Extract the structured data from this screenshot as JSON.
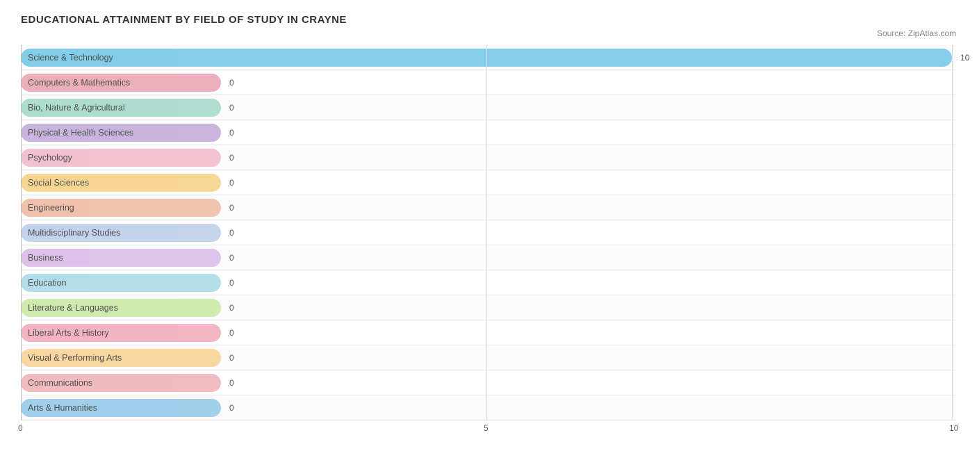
{
  "title": "EDUCATIONAL ATTAINMENT BY FIELD OF STUDY IN CRAYNE",
  "source": "Source: ZipAtlas.com",
  "chart": {
    "x_axis_labels": [
      "0",
      "5",
      "10"
    ],
    "max_value": 10,
    "bars": [
      {
        "label": "Science & Technology",
        "value": 10,
        "color": "#6ec6e8",
        "pct": 100
      },
      {
        "label": "Computers & Mathematics",
        "value": 0,
        "color": "#e8a0b0",
        "pct": 2.8
      },
      {
        "label": "Bio, Nature & Agricultural",
        "value": 0,
        "color": "#a0d8c8",
        "pct": 2.8
      },
      {
        "label": "Physical & Health Sciences",
        "value": 0,
        "color": "#b8a0d8",
        "pct": 2.8
      },
      {
        "label": "Psychology",
        "value": 0,
        "color": "#f0b8c0",
        "pct": 2.8
      },
      {
        "label": "Social Sciences",
        "value": 0,
        "color": "#f5d080",
        "pct": 2.8
      },
      {
        "label": "Engineering",
        "value": 0,
        "color": "#f0b8a8",
        "pct": 2.8
      },
      {
        "label": "Multidisciplinary Studies",
        "value": 0,
        "color": "#c8d8f0",
        "pct": 2.8
      },
      {
        "label": "Business",
        "value": 0,
        "color": "#d8c0e0",
        "pct": 2.8
      },
      {
        "label": "Education",
        "value": 0,
        "color": "#a8d8e8",
        "pct": 2.8
      },
      {
        "label": "Literature & Languages",
        "value": 0,
        "color": "#d0e8a0",
        "pct": 2.8
      },
      {
        "label": "Liberal Arts & History",
        "value": 0,
        "color": "#f0b0c0",
        "pct": 2.8
      },
      {
        "label": "Visual & Performing Arts",
        "value": 0,
        "color": "#f8d090",
        "pct": 2.8
      },
      {
        "label": "Communications",
        "value": 0,
        "color": "#f0b8c0",
        "pct": 2.8
      },
      {
        "label": "Arts & Humanities",
        "value": 0,
        "color": "#90c8e8",
        "pct": 2.8
      }
    ]
  }
}
